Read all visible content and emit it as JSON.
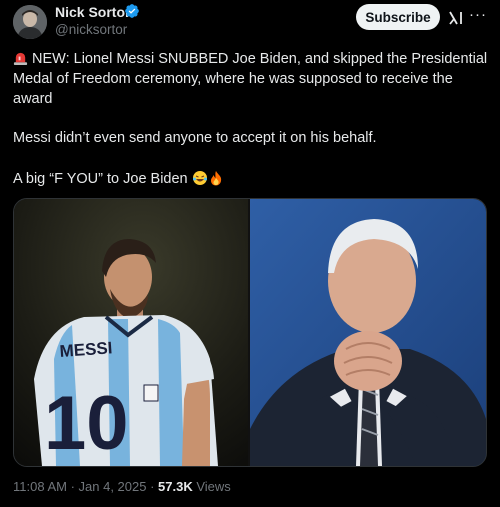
{
  "author": {
    "name": "Nick Sortor",
    "handle": "@nicksortor"
  },
  "actions": {
    "subscribe_label": "Subscribe",
    "more_label": "···"
  },
  "tweet": {
    "para1": "NEW: Lionel Messi SNUBBED Joe Biden, and skipped the Presidential Medal of Freedom ceremony, where he was supposed to receive the award",
    "para2": "Messi didn’t even send anyone to accept it on his behalf.",
    "para3": "A big “F YOU” to Joe Biden"
  },
  "media": {
    "left_jersey_name": "MESSI",
    "left_jersey_number": "10"
  },
  "footer": {
    "time": "11:08 AM",
    "sep1": " · ",
    "date": "Jan 4, 2025",
    "sep2": " · ",
    "views_count": "57.3K",
    "views_label": " Views"
  },
  "colors": {
    "verified": "#1d9bf0",
    "subscribe_bg": "#eff3f4",
    "muted": "#71767b"
  },
  "icons": [
    "avatar",
    "verified-badge-icon",
    "grok-icon",
    "more-icon",
    "siren-icon",
    "laughing-emoji-icon",
    "fire-emoji-icon"
  ]
}
